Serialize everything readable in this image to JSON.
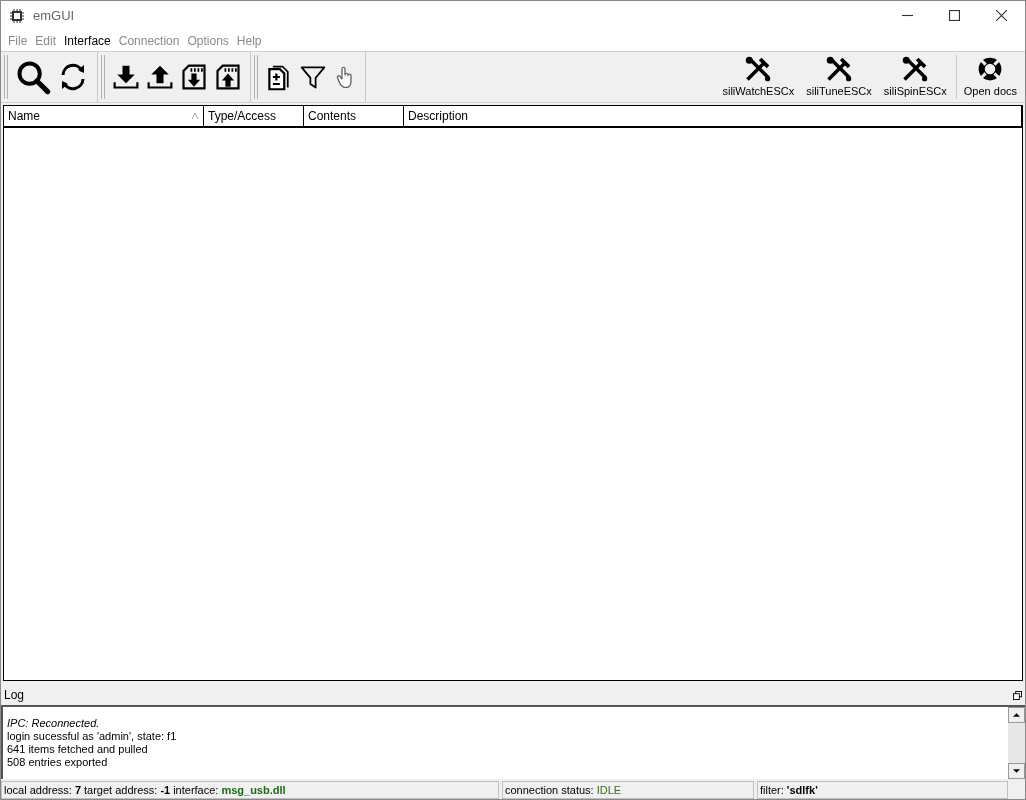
{
  "window": {
    "title": "emGUI"
  },
  "menu": [
    {
      "label": "File",
      "disabled": true
    },
    {
      "label": "Edit",
      "disabled": true
    },
    {
      "label": "Interface",
      "disabled": false
    },
    {
      "label": "Connection",
      "disabled": true
    },
    {
      "label": "Options",
      "disabled": true
    },
    {
      "label": "Help",
      "disabled": true
    }
  ],
  "tool_buttons": [
    {
      "label": "siliWatchESCx"
    },
    {
      "label": "siliTuneESCx"
    },
    {
      "label": "siliSpinESCx"
    }
  ],
  "docs_button": {
    "label": "Open docs"
  },
  "table": {
    "columns": [
      "Name",
      "Type/Access",
      "Contents",
      "Description"
    ]
  },
  "log": {
    "title": "Log",
    "lines": [
      {
        "text": "IPC: Reconnected.",
        "italic": true
      },
      {
        "text": "login sucessful as 'admin', state: f1",
        "italic": false
      },
      {
        "text": "641 items fetched and pulled",
        "italic": false
      },
      {
        "text": "508 entries exported",
        "italic": false
      }
    ]
  },
  "status_bar": {
    "addresses": [
      {
        "label": "local address:",
        "value": "7"
      },
      {
        "label": "target address:",
        "value": "-1"
      },
      {
        "label": "interface:",
        "value": "msg_usb.dll"
      }
    ],
    "connection": {
      "label": "connection status:",
      "value": "IDLE"
    },
    "filter": {
      "label": "filter:",
      "value": "'sdlfk'"
    }
  }
}
